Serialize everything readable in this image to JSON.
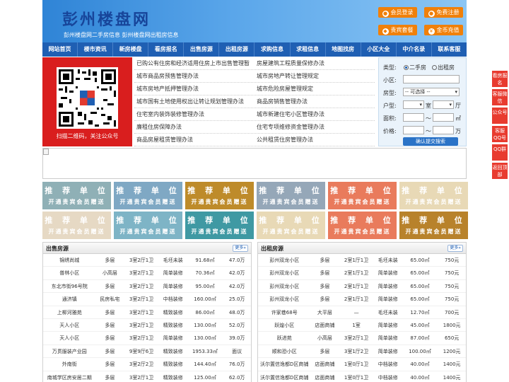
{
  "header": {
    "title": "彭州楼盘网",
    "subtitle": "彭州楼盘网二手房信息   彭州楼盘网出租房信息",
    "buttons": [
      "会员登录",
      "免费注册",
      "贵宾套餐",
      "金币充值"
    ]
  },
  "nav": [
    "网站首页",
    "楼市资讯",
    "新房楼盘",
    "看房报名",
    "出售房源",
    "出租房源",
    "求购信息",
    "求租信息",
    "地图找房",
    "小区大全",
    "中介名录",
    "联系客服"
  ],
  "qr": {
    "caption": "扫描二维码，关注公众号"
  },
  "news": [
    [
      "已购公有住房和经济适用住房上市出售管理暂",
      "房屋建筑工程质量保修办法"
    ],
    [
      "城市商品房预售管理办法",
      "城市房地产转让管理规定"
    ],
    [
      "城市房地产抵押管理办法",
      "城市危险房屋管理规定"
    ],
    [
      "城市国有土地使用权出让转让规划管理办法",
      "商品房销售管理办法"
    ],
    [
      "住宅室内装饰装修管理办法",
      "城市新建住宅小区管理办法"
    ],
    [
      "廉租住房保障办法",
      "住宅专项维修资金管理办法"
    ],
    [
      "商品房屋租赁管理办法",
      "公共租赁住房管理办法"
    ]
  ],
  "search": {
    "type_label": "类型:",
    "type_options": [
      "二手房",
      "出租房"
    ],
    "community_label": "小区:",
    "house_type_label": "房型:",
    "house_type_value": "-- 可选择 --",
    "layout_label": "户型:",
    "room_unit": "室",
    "hall_unit": "厅",
    "area_label": "面积:",
    "area_sep": "～",
    "area_unit": "㎡",
    "price_label": "价格:",
    "price_sep": "～",
    "price_unit": "万",
    "submit_label": "确认提交搜索"
  },
  "tiles": {
    "title": "推 荐 单 位",
    "sub": "开通贵宾会员赠送",
    "colors": [
      "#8fb0b6",
      "#7fa8c4",
      "#be8b2a",
      "#95a7b8",
      "#e97b5c",
      "#e8d9b6",
      "#e6d9c4",
      "#7eb4c6",
      "#3f99a3",
      "#e8d9b6",
      "#e97b5c",
      "#b8822b"
    ]
  },
  "sale": {
    "title": "出售房源",
    "more": "更多»",
    "rows": [
      [
        "锦绣尚城",
        "多层",
        "3室2厅1卫",
        "毛坯未装",
        "91.68㎡",
        "47.0万"
      ],
      [
        "普林小区",
        "小高层",
        "3室2厅1卫",
        "简单装修",
        "70.36㎡",
        "42.0万"
      ],
      [
        "东北市街96号院",
        "多层",
        "3室2厅1卫",
        "简单装修",
        "95.00㎡",
        "42.0万"
      ],
      [
        "通济镇",
        "民房私宅",
        "3室2厅1卫",
        "中档装修",
        "160.00㎡",
        "25.0万"
      ],
      [
        "上柳河雅苑",
        "多层",
        "3室2厅1卫",
        "精致装修",
        "86.00㎡",
        "48.0万"
      ],
      [
        "天人小区",
        "多层",
        "3室2厅1卫",
        "精致装修",
        "130.00㎡",
        "52.0万"
      ],
      [
        "天人小区",
        "多层",
        "3室2厅1卫",
        "简单装修",
        "130.00㎡",
        "39.0万"
      ],
      [
        "万贯服装产业园",
        "多层",
        "9室9厅6卫",
        "精致装修",
        "1953.33㎡",
        "面议"
      ],
      [
        "外南街",
        "多层",
        "3室2厅2卫",
        "精致装修",
        "144.40㎡",
        "76.0万"
      ],
      [
        "南城学区房安居二期",
        "多层",
        "3室2厅1卫",
        "精致装修",
        "125.00㎡",
        "62.0万"
      ]
    ]
  },
  "rent": {
    "title": "出租房源",
    "more": "更多»",
    "rows": [
      [
        "彭州双龙小区",
        "多层",
        "2室1厅1卫",
        "毛坯未装",
        "65.00㎡",
        "750元"
      ],
      [
        "彭州双龙小区",
        "多层",
        "2室1厅1卫",
        "简单装修",
        "65.00㎡",
        "750元"
      ],
      [
        "彭州双龙小区",
        "多层",
        "2室1厅1卫",
        "简单装修",
        "65.00㎡",
        "750元"
      ],
      [
        "彭州双龙小区",
        "多层",
        "2室1厅1卫",
        "简单装修",
        "65.00㎡",
        "750元"
      ],
      [
        "许家巷68号",
        "大平层",
        "—",
        "毛坯未装",
        "12.70㎡",
        "700元"
      ],
      [
        "跃煌小区",
        "店面商铺",
        "1室",
        "简单装修",
        "45.00㎡",
        "1800元"
      ],
      [
        "跃进苑",
        "小高层",
        "3室2厅1卫",
        "简单装修",
        "87.00㎡",
        "650元"
      ],
      [
        "顺和恐小区",
        "多层",
        "3室1厅2卫",
        "简单装修",
        "100.00㎡",
        "1200元"
      ],
      [
        "沃尔置信逸都D区商铺",
        "店面商铺",
        "1室0厅1卫",
        "中档装修",
        "40.00㎡",
        "1400元"
      ],
      [
        "沃尔置信逸都D区商铺",
        "店面商铺",
        "1室0厅1卫",
        "中档装修",
        "40.00㎡",
        "1400元"
      ]
    ]
  },
  "side": [
    "看房报名",
    "客服微信",
    "公众号",
    "客服QQ号",
    "QQ群",
    "返回顶部"
  ]
}
